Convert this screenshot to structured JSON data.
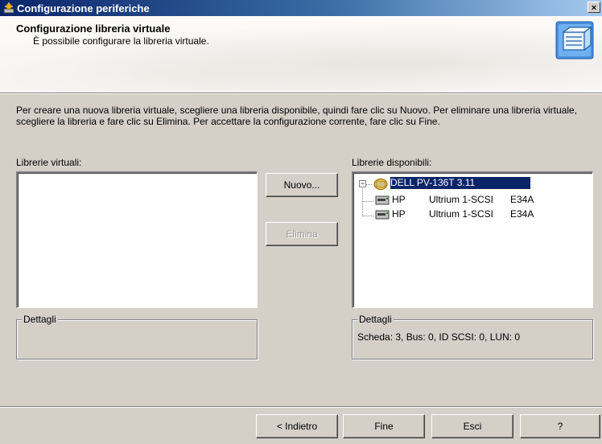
{
  "window": {
    "title": "Configurazione periferiche",
    "close_glyph": "×"
  },
  "header": {
    "title": "Configurazione libreria virtuale",
    "subtitle": "È possibile configurare la libreria virtuale.",
    "icon": "library-wizard-icon"
  },
  "intro": "Per creare una nuova libreria virtuale, scegliere una libreria disponibile, quindi fare clic su Nuovo. Per eliminare una libreria virtuale, scegliere la libreria e fare clic su Elimina. Per accettare la configurazione corrente, fare clic su Fine.",
  "virtual": {
    "label": "Librerie virtuali:",
    "details_legend": "Dettagli",
    "details_text": ""
  },
  "actions": {
    "new_label": "Nuovo...",
    "delete_label": "Elimina"
  },
  "available": {
    "label": "Librerie disponibili:",
    "tree": {
      "root": {
        "vendor": "DELL",
        "model": "PV-136T",
        "version": "3.11",
        "expander": "−",
        "icon": "library-icon"
      },
      "children": [
        {
          "vendor": "HP",
          "model": "Ultrium 1-SCSI",
          "version": "E34A",
          "icon": "tape-drive-icon"
        },
        {
          "vendor": "HP",
          "model": "Ultrium 1-SCSI",
          "version": "E34A",
          "icon": "tape-drive-icon"
        }
      ]
    },
    "details_legend": "Dettagli",
    "details_text": "Scheda: 3, Bus: 0, ID SCSI: 0, LUN: 0"
  },
  "footer": {
    "back_label": "< Indietro",
    "finish_label": "Fine",
    "exit_label": "Esci",
    "help_label": "?"
  },
  "colors": {
    "face": "#d4d0c8",
    "selection": "#0a246a",
    "title_gradient_start": "#0a246a",
    "title_gradient_end": "#a6caf0"
  }
}
